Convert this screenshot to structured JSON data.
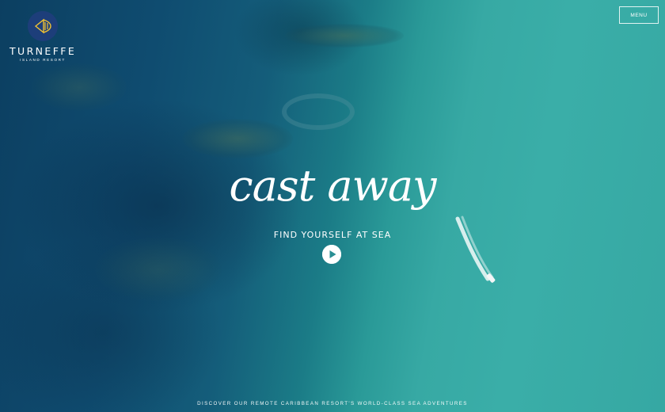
{
  "brand": {
    "name": "TURNEFFE",
    "subtitle": "ISLAND RESORT",
    "logo_icon": "fish-icon",
    "badge_color": "#1d3e7a",
    "accent_color": "#f0c232"
  },
  "header": {
    "menu_label": "MENU"
  },
  "hero": {
    "headline": "cast away",
    "subheadline": "FIND YOURSELF AT SEA",
    "play_icon": "play-icon",
    "tagline": "DISCOVER OUR REMOTE CARIBBEAN RESORT'S WORLD-CLASS SEA ADVENTURES",
    "background_image": "aerial ocean reef with speedboat"
  }
}
